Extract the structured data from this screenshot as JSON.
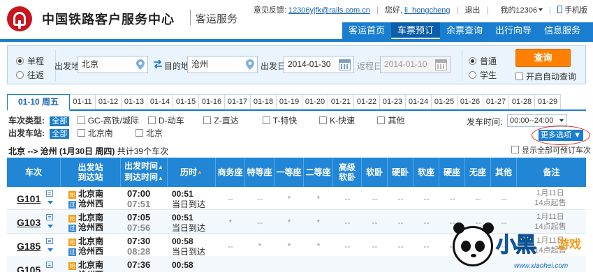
{
  "header": {
    "site_title": "中国铁路客户服务中心",
    "site_subtitle": "客运服务",
    "feedback_label": "意见反馈:",
    "feedback_email": "12306yjfk@rails.com.cn",
    "greeting": "您好,",
    "username": "li_hongcheng",
    "logout": "退出",
    "my12306": "我的12306",
    "mobile": "手机版"
  },
  "nav": {
    "items": [
      {
        "label": "客运首页"
      },
      {
        "label": "车票预订"
      },
      {
        "label": "余票查询"
      },
      {
        "label": "出行向导"
      },
      {
        "label": "信息服务"
      }
    ],
    "active_index": 1
  },
  "search": {
    "trip_oneway": "单程",
    "trip_round": "往返",
    "from_label": "出发地",
    "from_value": "北京",
    "to_label": "目的地",
    "to_value": "沧州",
    "date_label": "出发日",
    "date_value": "2014-01-30",
    "return_label": "返程日",
    "return_value": "2014-01-10",
    "ticket_normal": "普通",
    "ticket_student": "学生",
    "query_button": "查询",
    "auto_query": "开启自动查询"
  },
  "date_tabs": {
    "active": "01-10 周五",
    "items": [
      "01-11",
      "01-12",
      "01-13",
      "01-14",
      "01-15",
      "01-16",
      "01-17",
      "01-18",
      "01-19",
      "01-20",
      "01-21",
      "01-22",
      "01-23",
      "01-24",
      "01-25",
      "01-26",
      "01-27",
      "01-28",
      "01-29"
    ]
  },
  "filters": {
    "type_label": "车次类型:",
    "type_all": "全部",
    "types": [
      "GC-高铁/城际",
      "D-动车",
      "Z-直达",
      "T-特快",
      "K-快速",
      "其他"
    ],
    "station_label": "出发车站:",
    "station_all": "全部",
    "stations": [
      "北京南",
      "北京"
    ],
    "time_label": "发车时间:",
    "time_value": "00:00--24:00",
    "more_options": "更多选项"
  },
  "summary": {
    "route": "北京 --> 沧州",
    "date": "(1月30日  周四)",
    "count_text": "共计39个车次",
    "show_all": "显示全部可预订车次"
  },
  "table": {
    "headers": {
      "train": "车次",
      "station_from": "出发站",
      "station_to": "到达站",
      "time_dep": "出发时间",
      "time_arr": "到达时间",
      "duration": "历时",
      "business": "商务座",
      "special": "特等座",
      "first": "一等座",
      "second": "二等座",
      "soft_sleeper_adv_1": "高级",
      "soft_sleeper_adv_2": "软卧",
      "soft_sleeper": "软卧",
      "hard_sleeper": "硬卧",
      "soft_seat": "软座",
      "hard_seat": "硬座",
      "no_seat": "无座",
      "other": "其他",
      "note": "备注"
    },
    "rows": [
      {
        "train": "G101",
        "from": "北京南",
        "to": "沧州西",
        "dep": "07:00",
        "arr": "07:51",
        "dur": "00:51",
        "arrive_day": "当日到达",
        "seats": [
          "--",
          "--",
          "*",
          "*",
          "--",
          "--",
          "--",
          "--",
          "--",
          "--",
          "--"
        ],
        "note1": "1月11日",
        "note2": "14点起售"
      },
      {
        "train": "G103",
        "from": "北京南",
        "to": "沧州西",
        "dep": "07:05",
        "arr": "07:56",
        "dur": "00:51",
        "arrive_day": "当日到达",
        "seats": [
          "*",
          "--",
          "*",
          "*",
          "--",
          "--",
          "--",
          "--",
          "--",
          "--",
          "--"
        ],
        "note1": "1月11日",
        "note2": "14点起售"
      },
      {
        "train": "G185",
        "from": "北京南",
        "to": "沧州西",
        "dep": "07:30",
        "arr": "08:28",
        "dur": "00:58",
        "arrive_day": "当日到达",
        "seats": [
          "--",
          "*",
          "*",
          "*",
          "--",
          "--",
          "--",
          "--",
          "--",
          "--",
          "--"
        ],
        "note1": "1月11日",
        "note2": "14点起售"
      },
      {
        "train": "G105",
        "from": "北京南",
        "to": "沧州西",
        "dep": "07:36",
        "arr": "",
        "dur": "00:58",
        "arrive_day": "",
        "seats": [
          "",
          "",
          "",
          "",
          "",
          "",
          "",
          "",
          "",
          "",
          ""
        ],
        "note1": "",
        "note2": ""
      }
    ]
  },
  "watermark": {
    "big": "小黑",
    "small": "游戏",
    "url": "www.xiaohei.com"
  }
}
